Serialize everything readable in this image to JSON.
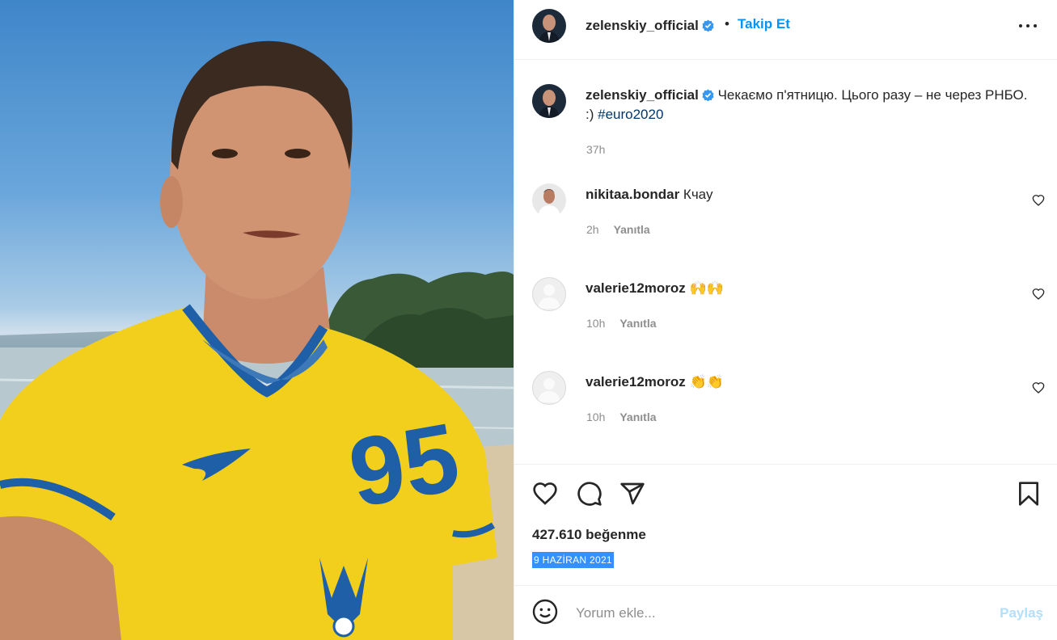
{
  "post": {
    "image_alt": "Selfie of a man in a yellow Ukraine football jersey by a lake",
    "jersey_number": "95"
  },
  "header": {
    "username": "zelenskiy_official",
    "separator": "•",
    "follow_label": "Takip Et",
    "more_icon": "more-horizontal-icon"
  },
  "caption": {
    "username": "zelenskiy_official",
    "text": "Чекаємо п'ятницю. Цього разу – не через РНБО. :) ",
    "hashtag": "#euro2020",
    "time": "37h"
  },
  "comments": [
    {
      "username": "nikitaa.bondar",
      "text": "Кчау",
      "time": "2h",
      "reply_label": "Yanıtla"
    },
    {
      "username": "valerie12moroz",
      "text": "🙌🙌",
      "time": "10h",
      "reply_label": "Yanıtla"
    },
    {
      "username": "valerie12moroz",
      "text": "👏👏",
      "time": "10h",
      "reply_label": "Yanıtla"
    }
  ],
  "actions": {
    "likes": "427.610 beğenme",
    "date": "9 HAZİRAN 2021"
  },
  "add_comment": {
    "placeholder": "Yorum ekle...",
    "share_label": "Paylaş"
  },
  "colors": {
    "link": "#0095f6",
    "hashtag": "#00376b",
    "jersey_yellow": "#f2cf1d",
    "jersey_blue": "#1f5fa8"
  }
}
